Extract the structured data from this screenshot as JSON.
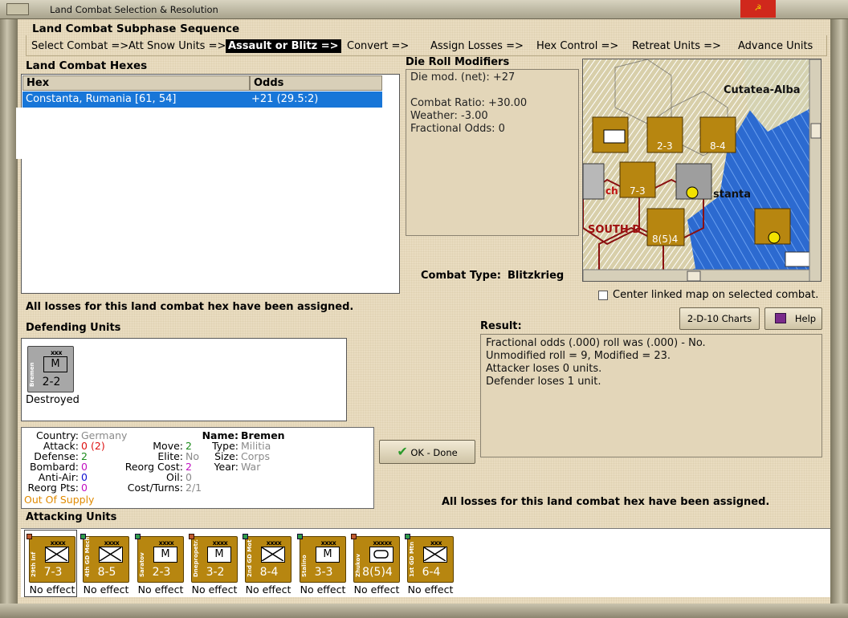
{
  "window": {
    "title": "Land Combat Selection & Resolution"
  },
  "subphase": {
    "title": "Land Combat Subphase Sequence",
    "steps": [
      "Select Combat =>",
      "Att Snow Units =>",
      "Assault or Blitz =>",
      "Convert =>",
      "Assign Losses =>",
      "Hex Control =>",
      "Retreat Units =>",
      "Advance Units"
    ],
    "active_step": "Assault or Blitz =>"
  },
  "hexes": {
    "title": "Land Combat Hexes",
    "columns": [
      "Hex",
      "Odds"
    ],
    "rows": [
      {
        "hex": "Constanta, Rumania [61, 54]",
        "odds": "+21 (29.5:2)"
      }
    ]
  },
  "die_roll": {
    "title": "Die Roll Modifiers",
    "lines": [
      "Die mod. (net): +27",
      "",
      "Combat Ratio: +30.00",
      "Weather: -3.00",
      "Fractional Odds: 0"
    ]
  },
  "combat_type": {
    "label": "Combat Type:",
    "value": "Blitzkrieg"
  },
  "map": {
    "labels": [
      "Cutatea-Alba",
      "stanta",
      "SOUTH D",
      "ch"
    ],
    "center_linked_label": "Center linked map on selected combat."
  },
  "buttons": {
    "charts": "2-D-10 Charts",
    "help": "Help",
    "ok": "OK - Done"
  },
  "losses_msg": "All losses for this land combat hex have been assigned.",
  "defending": {
    "title": "Defending Units",
    "units": [
      {
        "name": "Bremen",
        "size": "xxx",
        "type_sym": "M",
        "strength": "2-2",
        "status": "Destroyed"
      }
    ]
  },
  "unit_info": {
    "country_label": "Country:",
    "country": "Germany",
    "attack_label": "Attack:",
    "attack": "0",
    "attack_alt": "(2)",
    "defense_label": "Defense:",
    "defense": "2",
    "bombard_label": "Bombard:",
    "bombard": "0",
    "antiair_label": "Anti-Air:",
    "antiair": "0",
    "reorg_pts_label": "Reorg Pts:",
    "reorg_pts": "0",
    "supply": "Out Of Supply",
    "move_label": "Move:",
    "move": "2",
    "elite_label": "Elite:",
    "elite": "No",
    "reorg_cost_label": "Reorg Cost:",
    "reorg_cost": "2",
    "oil_label": "Oil:",
    "oil": "0",
    "cost_turns_label": "Cost/Turns:",
    "cost_turns": "2/1",
    "name_label": "Name:",
    "name": "Bremen",
    "type_label": "Type:",
    "type": "Militia",
    "size_label": "Size:",
    "size": "Corps",
    "year_label": "Year:",
    "year": "War"
  },
  "result": {
    "title": "Result:",
    "lines": [
      "Fractional odds (.000) roll was (.000)  - No.",
      "Unmodified roll = 9, Modified = 23.",
      "Attacker loses 0 units.",
      "Defender loses 1 unit."
    ]
  },
  "attacking": {
    "title": "Attacking Units",
    "units": [
      {
        "name": "29th Inf",
        "size": "xxxx",
        "sym": "inf",
        "strength": "7-3",
        "effect": "No effect"
      },
      {
        "name": "4th GD Mech",
        "size": "xxxx",
        "sym": "inf",
        "strength": "8-5",
        "effect": "No effect"
      },
      {
        "name": "Saratov",
        "size": "xxxx",
        "sym": "M",
        "strength": "2-3",
        "effect": "No effect"
      },
      {
        "name": "Dnepropetr.",
        "size": "xxxx",
        "sym": "M",
        "strength": "3-2",
        "effect": "No effect"
      },
      {
        "name": "2nd GD Mot",
        "size": "xxxx",
        "sym": "inf",
        "strength": "8-4",
        "effect": "No effect"
      },
      {
        "name": "Stalino",
        "size": "xxxx",
        "sym": "M",
        "strength": "3-3",
        "effect": "No effect"
      },
      {
        "name": "Zhukov",
        "size": "xxxxx",
        "sym": "arm",
        "strength": "8(5)4",
        "effect": "No effect"
      },
      {
        "name": "1st GD Mtn",
        "size": "xxx",
        "sym": "inf",
        "strength": "6-4",
        "effect": "No effect"
      }
    ]
  },
  "colors": {
    "attack_red": "#d11",
    "defense_green": "#1a8a1a",
    "bombard_mag": "#c010c0",
    "aa_blue": "#1010d0",
    "supply_orange": "#e08a00",
    "selected_row": "#1876d8",
    "counter_gold": "#b78610"
  }
}
